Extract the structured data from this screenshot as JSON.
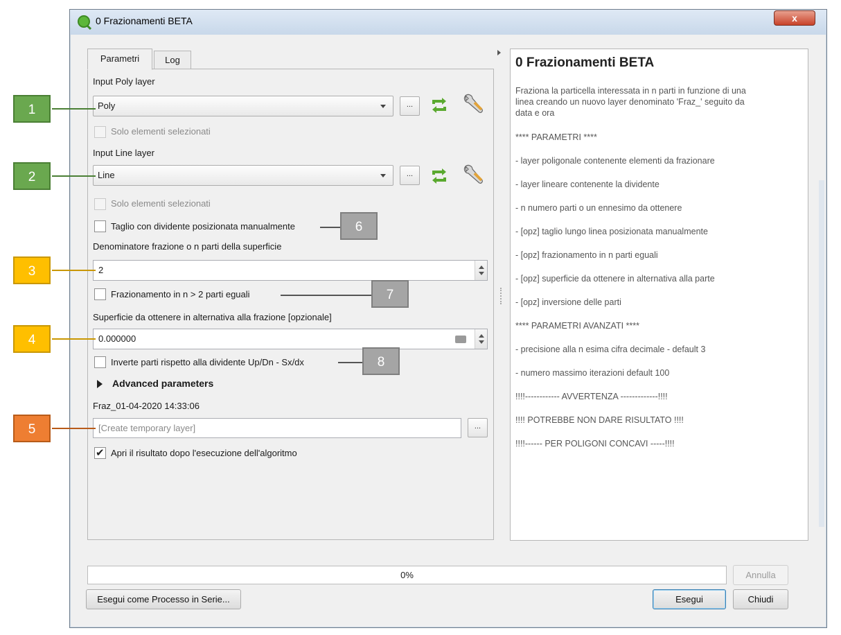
{
  "window": {
    "title": "0 Frazionamenti BETA",
    "close_label": "x"
  },
  "tabs": [
    {
      "label": "Parametri"
    },
    {
      "label": "Log"
    }
  ],
  "form": {
    "poly_label": "Input Poly layer",
    "poly_value": "Poly",
    "poly_selected_only": "Solo elementi selezionati",
    "line_label": "Input Line layer",
    "line_value": "Line",
    "line_selected_only": "Solo elementi selezionati",
    "manual_cut_label": "Taglio con dividente posizionata manualmente",
    "denominator_label": "Denominatore frazione o n parti della superficie",
    "denominator_value": "2",
    "equal_parts_label": "Frazionamento in n > 2 parti eguali",
    "area_label": "Superficie da ottenere in alternativa alla frazione [opzionale]",
    "area_value": "0.000000",
    "invert_label": "Inverte parti rispetto alla dividente Up/Dn - Sx/dx",
    "advanced_label": "Advanced parameters",
    "output_name": "Fraz_01-04-2020 14:33:06",
    "output_placeholder": "[Create temporary layer]",
    "open_result_label": "Apri il risultato dopo l'esecuzione dell'algoritmo",
    "dots": "..."
  },
  "help": {
    "title": "0 Frazionamenti BETA",
    "intro": [
      "Fraziona la particella interessata in n parti in funzione di una",
      "linea creando un nuovo layer denominato 'Fraz_' seguito da",
      "data e ora"
    ],
    "lines": [
      "**** PARAMETRI ****",
      "- layer poligonale contenente elementi da frazionare",
      "- layer lineare contenente la dividente",
      "- n numero parti o un ennesimo da ottenere",
      "- [opz] taglio lungo linea posizionata manualmente",
      "- [opz] frazionamento in n parti eguali",
      "- [opz] superficie da ottenere in alternativa alla parte",
      "- [opz] inversione delle parti",
      "**** PARAMETRI AVANZATI ****",
      "- precisione alla n esima cifra decimale - default 3",
      "- numero massimo iterazioni default 100",
      "!!!!------------ AVVERTENZA -------------!!!!",
      "!!!! POTREBBE NON DARE RISULTATO !!!!",
      "!!!!------ PER POLIGONI CONCAVI -----!!!!"
    ]
  },
  "annotations": [
    "1",
    "2",
    "3",
    "4",
    "5",
    "6",
    "7",
    "8"
  ],
  "progress": {
    "label": "0%",
    "value": 0
  },
  "buttons": {
    "cancel": "Annulla",
    "batch": "Esegui come Processo in Serie...",
    "run": "Esegui",
    "close": "Chiudi"
  },
  "colors": {
    "green": "#6aa84f",
    "gold": "#ffbf00",
    "orange": "#ee7e32",
    "gray": "#a5a5a5"
  }
}
